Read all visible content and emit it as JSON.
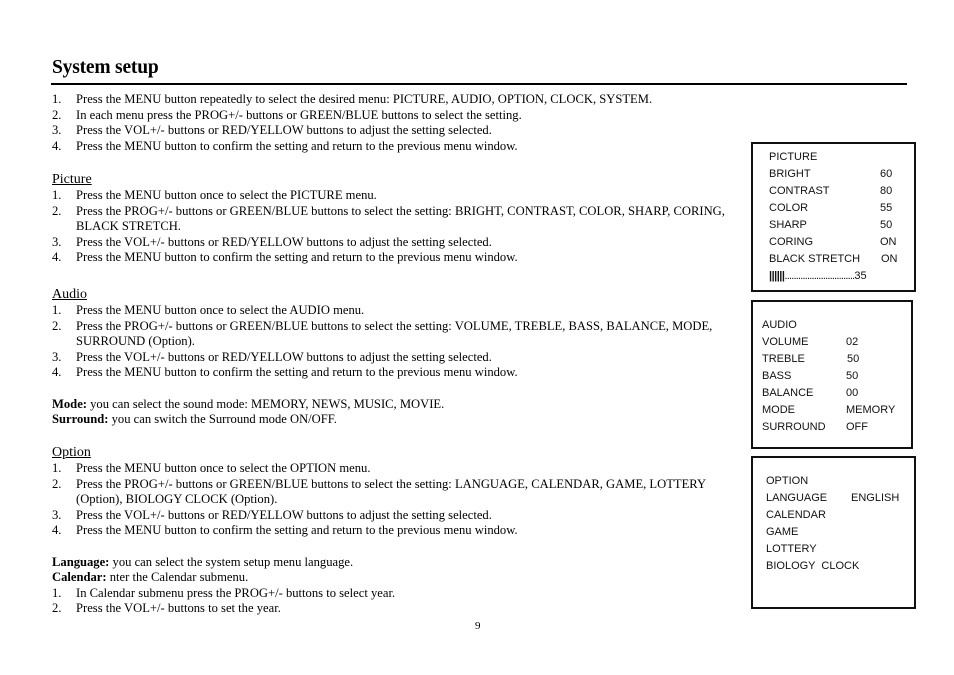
{
  "title": "System setup",
  "intro": {
    "steps": [
      "Press the MENU button repeatedly to select the desired menu: PICTURE, AUDIO, OPTION, CLOCK, SYSTEM.",
      "In each menu press the PROG+/- buttons or GREEN/BLUE buttons to select the setting.",
      "Press the VOL+/- buttons or RED/YELLOW buttons to adjust the setting selected.",
      "Press the MENU button to confirm the setting and return to the previous menu window."
    ]
  },
  "picture": {
    "heading": "Picture",
    "steps": [
      "Press the MENU button once to select the PICTURE menu.",
      "Press the PROG+/- buttons or GREEN/BLUE buttons to select the setting: BRIGHT, CONTRAST, COLOR, SHARP, CORING, BLACK STRETCH.",
      "Press the VOL+/- buttons or RED/YELLOW buttons to adjust the setting selected.",
      "Press the MENU button to confirm the setting and return to the previous menu window."
    ]
  },
  "audio": {
    "heading": "Audio",
    "steps": [
      "Press the MENU button once to select the AUDIO menu.",
      "Press the PROG+/- buttons or GREEN/BLUE buttons to select the setting: VOLUME, TREBLE, BASS, BALANCE, MODE, SURROUND (Option).",
      "Press the VOL+/- buttons or RED/YELLOW buttons to adjust the setting selected.",
      "Press the MENU button to confirm the setting and return to the previous menu window."
    ],
    "notes": [
      {
        "term": "Mode:",
        "text": " you can select the sound mode: MEMORY, NEWS, MUSIC, MOVIE."
      },
      {
        "term": "Surround:",
        "text": " you can switch the Surround mode ON/OFF."
      }
    ]
  },
  "option": {
    "heading": "Option",
    "steps": [
      "Press the MENU button once to select the OPTION menu.",
      "Press the PROG+/- buttons or GREEN/BLUE buttons to select the setting: LANGUAGE, CALENDAR, GAME, LOTTERY (Option), BIOLOGY CLOCK (Option).",
      "Press the VOL+/- buttons or RED/YELLOW buttons to adjust the setting selected.",
      "Press the MENU button to confirm the setting and return to the previous menu window."
    ],
    "notes": [
      {
        "term": "Language:",
        "text": " you can select the system setup menu language."
      },
      {
        "term": "Calendar:",
        "text": " nter the Calendar submenu."
      }
    ],
    "calendar_steps": [
      "In Calendar submenu press the PROG+/- buttons to select year.",
      "Press the VOL+/- buttons to set the year."
    ]
  },
  "menus": {
    "picture": {
      "title": "PICTURE",
      "items": [
        {
          "label": "BRIGHT",
          "value": "60"
        },
        {
          "label": "CONTRAST",
          "value": "80"
        },
        {
          "label": "COLOR",
          "value": "55"
        },
        {
          "label": "SHARP",
          "value": "50"
        },
        {
          "label": "CORING",
          "value": "ON"
        },
        {
          "label": "BLACK STRETCH",
          "value": "ON"
        }
      ],
      "bar": {
        "ticks": "||||||",
        "dots": "...............................",
        "value": "35"
      }
    },
    "audio": {
      "title": "AUDIO",
      "items": [
        {
          "label": "VOLUME",
          "value": "02"
        },
        {
          "label": "TREBLE",
          "value": "50"
        },
        {
          "label": "BASS",
          "value": "50"
        },
        {
          "label": "BALANCE",
          "value": "00"
        },
        {
          "label": "MODE",
          "value": "MEMORY"
        },
        {
          "label": "SURROUND",
          "value": "OFF"
        }
      ]
    },
    "option": {
      "title": "OPTION",
      "items": [
        {
          "label": "LANGUAGE",
          "value": "ENGLISH"
        },
        {
          "label": "CALENDAR",
          "value": ""
        },
        {
          "label": "GAME",
          "value": ""
        },
        {
          "label": "LOTTERY",
          "value": ""
        },
        {
          "label": "BIOLOGY  CLOCK",
          "value": ""
        }
      ]
    }
  },
  "page_number": "9"
}
